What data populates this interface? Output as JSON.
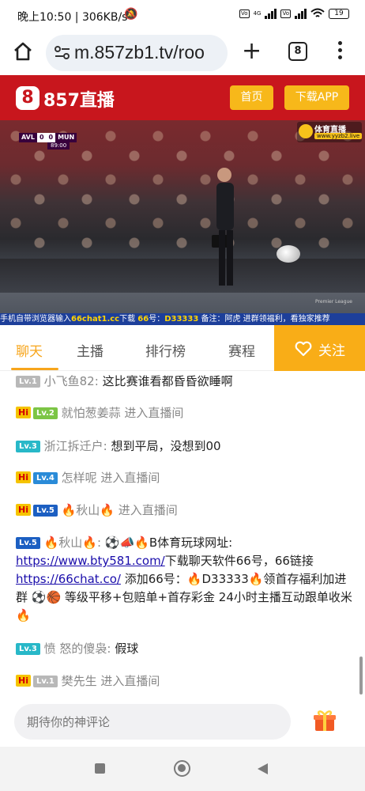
{
  "status_bar": {
    "time_speed": "晚上10:50 | 306KB/s",
    "network_1": "4G",
    "battery": "19"
  },
  "browser": {
    "url": "m.857zb1.tv/roo",
    "tab_count": "8"
  },
  "site_header": {
    "logo_badge": "8",
    "logo_text": "857直播",
    "home_button": "首页",
    "download_button": "下载APP"
  },
  "video": {
    "team_home": "AVL",
    "score_home": "0",
    "score_away": "0",
    "team_away": "MUN",
    "clock": "89:00",
    "watermark_title": "体育直播",
    "watermark_url": "www.yyzb2.live",
    "premier_league": "Premier League",
    "ticker_prefix": "手机自带浏览器输入",
    "ticker_site": "66chat1.cc",
    "ticker_mid": "下载  ",
    "ticker_num": "66",
    "ticker_mid2": "号：",
    "ticker_code": "D33333",
    "ticker_suffix": " 备注：阿虎 进群领福利，看独家推荐"
  },
  "tabs": [
    {
      "label": "聊天"
    },
    {
      "label": "主播"
    },
    {
      "label": "排行榜"
    },
    {
      "label": "赛程"
    }
  ],
  "follow_label": "关注",
  "colors": {
    "lv1": "#b8b8b8",
    "lv2": "#7cc545",
    "lv3": "#28b8c8",
    "lv4": "#2a8bd8",
    "lv5": "#1c5fc2",
    "accent": "#f7a51b"
  },
  "messages": [
    {
      "level": "Lv.1",
      "nick": "小飞鱼82:",
      "text": "这比赛谁看都昏昏欲睡啊"
    },
    {
      "hi": "Hi",
      "level": "Lv.2",
      "nick": "就怕葱姜蒜",
      "text": "进入直播间"
    },
    {
      "level": "Lv.3",
      "nick": "浙江拆迁户:",
      "text": "想到平局，没想到00"
    },
    {
      "hi": "Hi",
      "level": "Lv.4",
      "nick": "怎样呢",
      "text": "进入直播间"
    },
    {
      "hi": "Hi",
      "level": "Lv.5",
      "nick": "🔥秋山🔥",
      "text": "进入直播间"
    },
    {
      "level": "Lv.5",
      "nick": "🔥秋山🔥:",
      "text_a": "⚽📣🔥B体育玩球网址:",
      "link_a": "https://www.bty581.com/",
      "text_b": "下载聊天软件66号，66链接",
      "link_b": "https://66chat.co/",
      "text_c": " 添加66号：🔥D33333🔥领首存福利加进群 ⚽🏀 等级平移+包赔单+首存彩金 24小时主播互动跟单收米🔥"
    },
    {
      "level": "Lv.3",
      "nick": "愤 怒的傻袅:",
      "text": "假球"
    },
    {
      "hi": "Hi",
      "level": "Lv.1",
      "nick": "樊先生",
      "text": "进入直播间"
    }
  ],
  "comment_placeholder": "期待你的神评论"
}
